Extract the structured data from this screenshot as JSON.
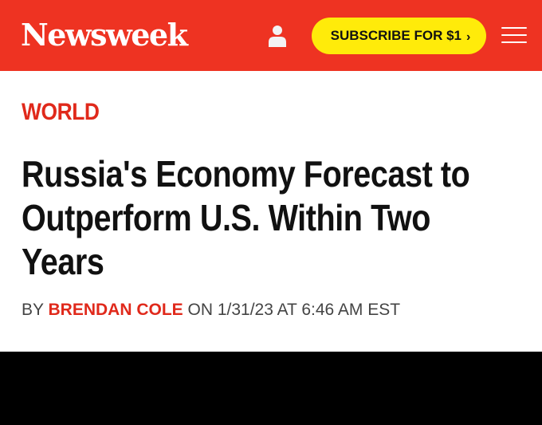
{
  "header": {
    "logo": "Newsweek",
    "subscribe_label": "SUBSCRIBE FOR $1",
    "subscribe_chevron": "›",
    "account_icon": "user-icon",
    "menu_icon": "hamburger-menu-icon",
    "colors": {
      "bar": "#ee3322",
      "subscribe_bg": "#ffeb0a"
    }
  },
  "article": {
    "section": "WORLD",
    "headline": "Russia's Economy Forecast to Outperform U.S. Within Two Years",
    "byline": {
      "prefix": "BY",
      "author": "BRENDAN COLE",
      "on": "ON",
      "datetime": "1/31/23 AT 6:46 AM EST"
    },
    "colors": {
      "section": "#e0291b",
      "author": "#e0291b"
    }
  }
}
